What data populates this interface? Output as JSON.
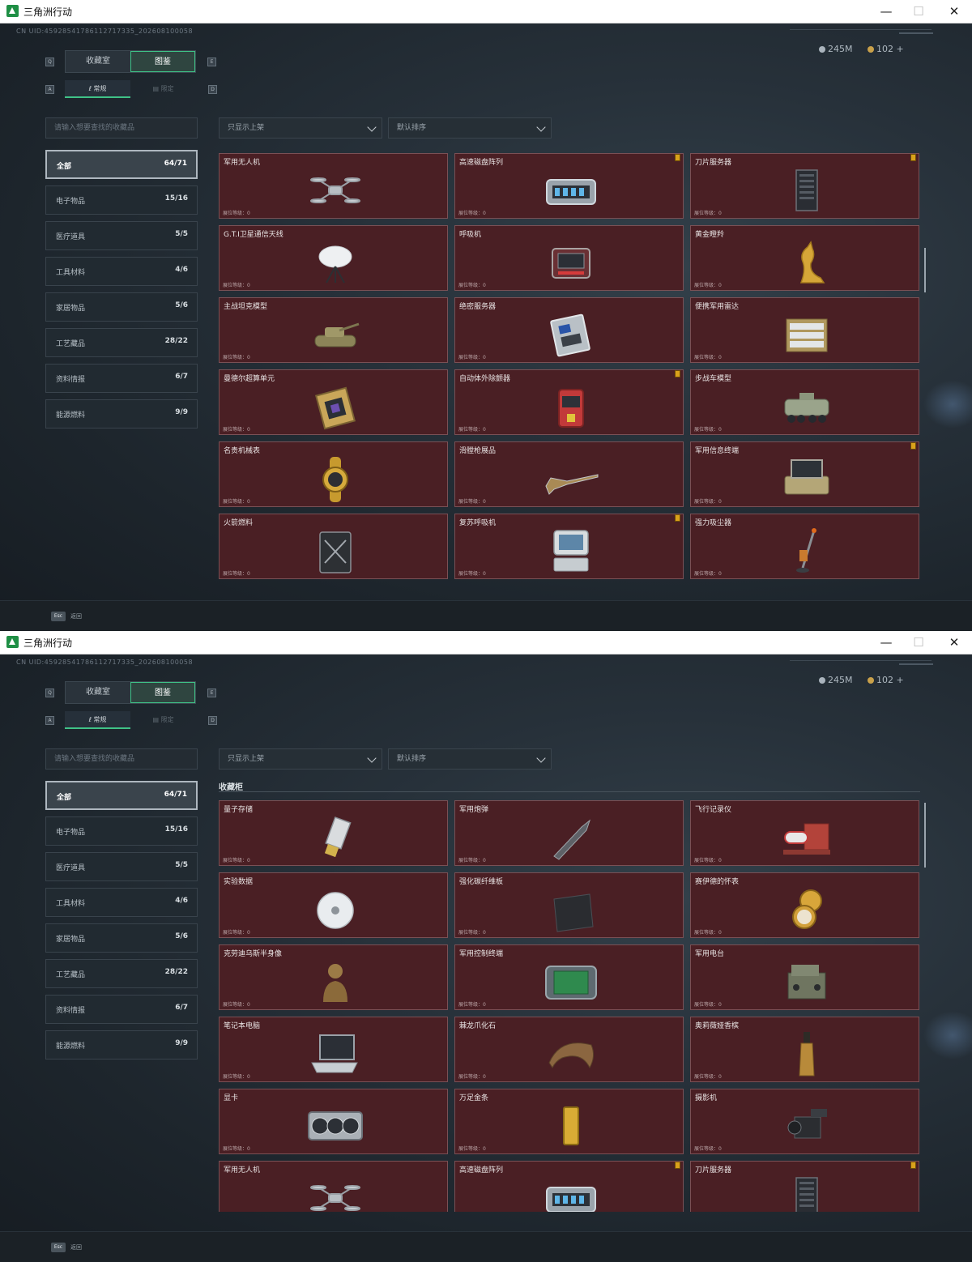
{
  "windows": [
    {
      "app_title": "三角洲行动",
      "uid_text": "CN UID:4592854178611271733​5_2026081000​58",
      "currency": [
        {
          "name": "silver-coin-icon",
          "value": "245M"
        },
        {
          "name": "gold-coin-icon",
          "value": "102 +"
        }
      ],
      "keys": {
        "tab_left": "Q",
        "tab_right": "E",
        "sub_left": "A",
        "sub_right": "D"
      },
      "tabs": [
        "收藏室",
        "图鉴"
      ],
      "active_tab": 1,
      "subtabs": [
        "常规",
        "限定"
      ],
      "search_placeholder": "请输入想要查找的收藏品",
      "categories": [
        {
          "name": "全部",
          "count": "64/71"
        },
        {
          "name": "电子物品",
          "count": "15/16"
        },
        {
          "name": "医疗道具",
          "count": "5/5"
        },
        {
          "name": "工具材料",
          "count": "4/6"
        },
        {
          "name": "家居物品",
          "count": "5/6"
        },
        {
          "name": "工艺藏品",
          "count": "28/22"
        },
        {
          "name": "资料情报",
          "count": "6/7"
        },
        {
          "name": "能源燃料",
          "count": "9/9"
        }
      ],
      "filter_dropdown": "只显示上架",
      "sort_dropdown": "默认排序",
      "section_title": "",
      "level_label": "展位等级：0",
      "cards": [
        {
          "name": "军用无人机",
          "badge": false,
          "art": "drone"
        },
        {
          "name": "高速磁盘阵列",
          "badge": true,
          "art": "disk"
        },
        {
          "name": "刀片服务器",
          "badge": true,
          "art": "server"
        },
        {
          "name": "G.T.I卫星通信天线",
          "badge": false,
          "art": "dish"
        },
        {
          "name": "呼吸机",
          "badge": false,
          "art": "ventilator"
        },
        {
          "name": "黄金瞪羚",
          "badge": false,
          "art": "gazelle"
        },
        {
          "name": "主战坦克模型",
          "badge": false,
          "art": "tank"
        },
        {
          "name": "绝密服务器",
          "badge": false,
          "art": "board"
        },
        {
          "name": "便携军用雷达",
          "badge": false,
          "art": "radar"
        },
        {
          "name": "曼德尔超算单元",
          "badge": false,
          "art": "chip"
        },
        {
          "name": "自动体外除颤器",
          "badge": true,
          "art": "aed"
        },
        {
          "name": "步战车模型",
          "badge": false,
          "art": "ifv"
        },
        {
          "name": "名贵机械表",
          "badge": false,
          "art": "watch"
        },
        {
          "name": "滑膛枪展品",
          "badge": false,
          "art": "musket"
        },
        {
          "name": "军用信息终端",
          "badge": true,
          "art": "terminal"
        },
        {
          "name": "火箭燃料",
          "badge": false,
          "art": "jerrycan"
        },
        {
          "name": "复苏呼吸机",
          "badge": true,
          "art": "monitor"
        },
        {
          "name": "强力吸尘器",
          "badge": false,
          "art": "vacuum"
        }
      ],
      "esc_key": "Esc",
      "esc_label": "返回"
    },
    {
      "app_title": "三角洲行动",
      "uid_text": "CN UID:4592854178611271733​5_2026081000​58",
      "currency": [
        {
          "name": "silver-coin-icon",
          "value": "245M"
        },
        {
          "name": "gold-coin-icon",
          "value": "102 +"
        }
      ],
      "keys": {
        "tab_left": "Q",
        "tab_right": "E",
        "sub_left": "A",
        "sub_right": "D"
      },
      "tabs": [
        "收藏室",
        "图鉴"
      ],
      "active_tab": 1,
      "subtabs": [
        "常规",
        "限定"
      ],
      "search_placeholder": "请输入想要查找的收藏品",
      "categories": [
        {
          "name": "全部",
          "count": "64/71"
        },
        {
          "name": "电子物品",
          "count": "15/16"
        },
        {
          "name": "医疗道具",
          "count": "5/5"
        },
        {
          "name": "工具材料",
          "count": "4/6"
        },
        {
          "name": "家居物品",
          "count": "5/6"
        },
        {
          "name": "工艺藏品",
          "count": "28/22"
        },
        {
          "name": "资料情报",
          "count": "6/7"
        },
        {
          "name": "能源燃料",
          "count": "9/9"
        }
      ],
      "filter_dropdown": "只显示上架",
      "sort_dropdown": "默认排序",
      "section_title": "收藏柜",
      "level_label": "展位等级：0",
      "cards": [
        {
          "name": "量子存储",
          "badge": false,
          "art": "usb"
        },
        {
          "name": "军用炮弹",
          "badge": false,
          "art": "shell"
        },
        {
          "name": "飞行记录仪",
          "badge": false,
          "art": "recorder"
        },
        {
          "name": "实验数据",
          "badge": false,
          "art": "disc"
        },
        {
          "name": "强化碳纤维板",
          "badge": false,
          "art": "plate"
        },
        {
          "name": "赛伊德的怀表",
          "badge": false,
          "art": "pocketwatch"
        },
        {
          "name": "克劳迪乌斯半身像",
          "badge": false,
          "art": "bust"
        },
        {
          "name": "军用控制终端",
          "badge": false,
          "art": "controlpad"
        },
        {
          "name": "军用电台",
          "badge": false,
          "art": "radio"
        },
        {
          "name": "笔记本电脑",
          "badge": false,
          "art": "laptop"
        },
        {
          "name": "棘龙爪化石",
          "badge": false,
          "art": "claw"
        },
        {
          "name": "奥莉薇娅香槟",
          "badge": false,
          "art": "bottle"
        },
        {
          "name": "显卡",
          "badge": false,
          "art": "gpu"
        },
        {
          "name": "万足金条",
          "badge": false,
          "art": "goldbar"
        },
        {
          "name": "摄影机",
          "badge": false,
          "art": "camera"
        },
        {
          "name": "军用无人机",
          "badge": false,
          "art": "drone"
        },
        {
          "name": "高速磁盘阵列",
          "badge": true,
          "art": "disk"
        },
        {
          "name": "刀片服务器",
          "badge": true,
          "art": "server"
        }
      ],
      "esc_key": "Esc",
      "esc_label": "返回"
    }
  ],
  "colors": {
    "accent": "#3fc287",
    "card_bg": "#4a1f24",
    "badge": "#d9a11b"
  }
}
